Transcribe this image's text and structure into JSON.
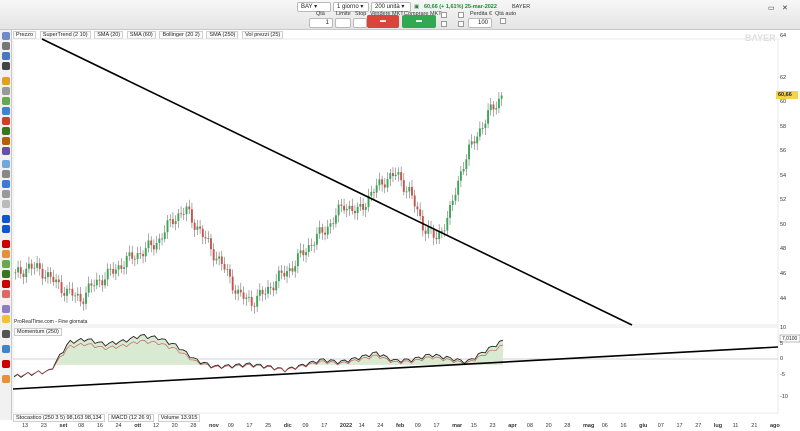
{
  "toolbar": {
    "symbol": "BAY",
    "timeframe": "1 giorno",
    "units": "200 unità",
    "quote": "60,66 (+ 1,61%) 25-mar-2022",
    "instrument": "BAYER",
    "qty_label": "Qtà",
    "qty_value": "1",
    "limit_label": "Limite",
    "stop_label": "Stop",
    "sell_label": "Vendere MKT",
    "buy_label": "Comprare MKT",
    "loss_label": "Perdita €",
    "loss_value": "100",
    "qty_auto_label": "Qtà auto",
    "sell_color": "#d9443b",
    "buy_color": "#33a853"
  },
  "legend": {
    "items": [
      "Prezzo",
      "SuperTrend (2 10)",
      "SMA (20)",
      "SMA (60)",
      "Bollinger (20 2)",
      "SMA (250)",
      "Vol prezzi (25)"
    ]
  },
  "watermark": "BAYER",
  "source_note": "ProRealTime.com - Fine giornata",
  "last_price_tag": "60,66",
  "momentum_label": "Momentum (250)",
  "momentum_value_tag": "7,0100",
  "bottom_legend": [
    "Stocastico (250 3 5) 98,163 98,134",
    "MACD (12 26 9)",
    "Volume 13.915"
  ],
  "price_axis": [
    "64",
    "62",
    "60",
    "58",
    "56",
    "54",
    "52",
    "50",
    "48",
    "46",
    "44"
  ],
  "momentum_axis": [
    "10",
    "5",
    "0",
    "-5",
    "-10"
  ],
  "time_axis": [
    "13",
    "23",
    "set",
    "08",
    "16",
    "24",
    "ott",
    "12",
    "20",
    "28",
    "nov",
    "09",
    "17",
    "25",
    "dic",
    "09",
    "17",
    "2022",
    "14",
    "24",
    "feb",
    "09",
    "17",
    "mar",
    "15",
    "23",
    "apr",
    "08",
    "20",
    "28",
    "mag",
    "06",
    "16",
    "giu",
    "07",
    "17",
    "27",
    "lug",
    "11",
    "21",
    "ago"
  ],
  "chart_data": {
    "type": "candlestick",
    "series": [
      {
        "name": "Prezzo",
        "close_approx": [
          46.8,
          47.5,
          47.2,
          46.3,
          45.5,
          45.0,
          46.2,
          46.8,
          47.6,
          48.3,
          48.8,
          49.6,
          51.2,
          51.8,
          50.3,
          48.7,
          47.2,
          45.3,
          44.8,
          45.5,
          46.6,
          47.4,
          48.7,
          49.8,
          50.8,
          52.3,
          51.6,
          53.0,
          54.1,
          54.6,
          53.2,
          50.7,
          49.6,
          51.4,
          55.2,
          57.4,
          59.2,
          60.66
        ]
      },
      {
        "name": "Momentum (250)",
        "values_approx": [
          -3.5,
          -2.5,
          -1.8,
          6.5,
          7.5,
          6.0,
          6.8,
          8.5,
          7.8,
          5.5,
          1.5,
          -0.5,
          -0.3,
          0.2,
          -0.5,
          -1.5,
          0.0,
          1.5,
          0.8,
          2.0,
          3.5,
          1.2,
          1.5,
          3.0,
          2.0,
          0.8,
          4.0,
          7.01
        ]
      }
    ],
    "ylim_price": [
      43,
      65
    ],
    "ylim_momentum": [
      -14,
      11
    ]
  }
}
